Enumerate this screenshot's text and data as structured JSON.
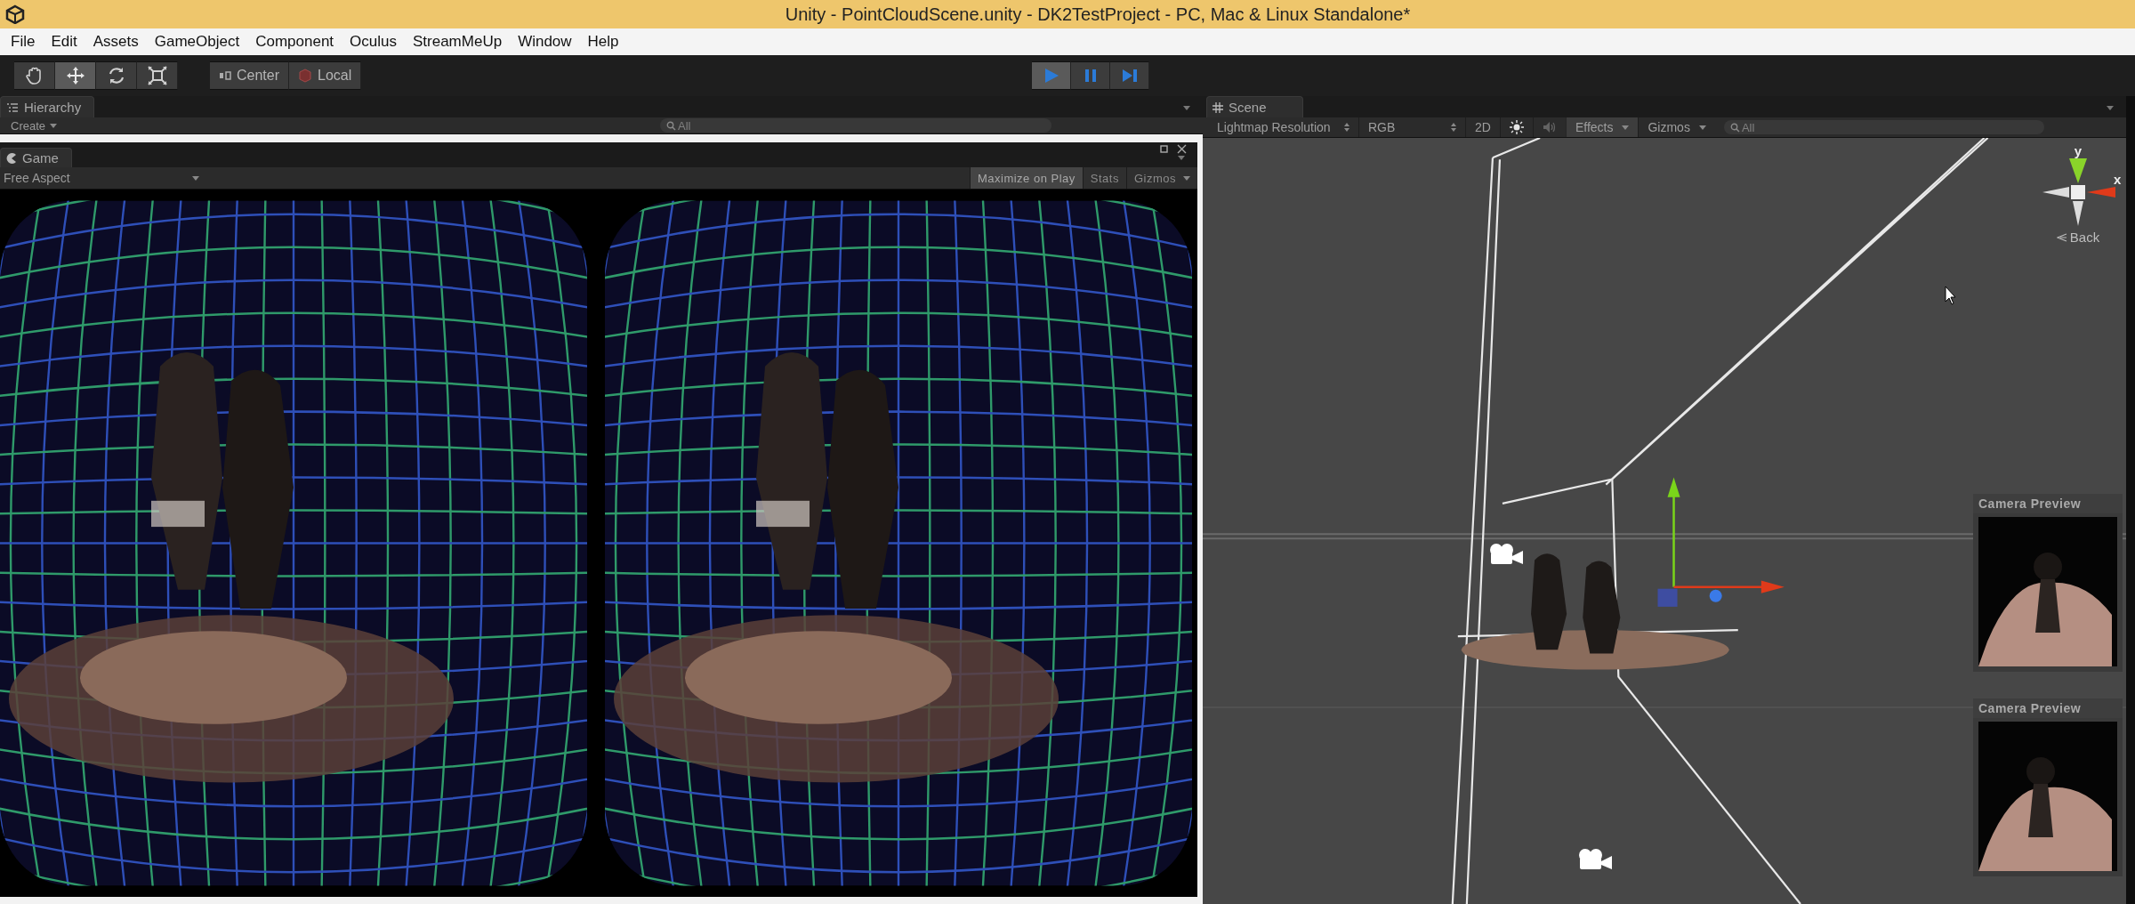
{
  "window": {
    "title": "Unity - PointCloudScene.unity - DK2TestProject - PC, Mac & Linux Standalone*"
  },
  "menu": [
    "File",
    "Edit",
    "Assets",
    "GameObject",
    "Component",
    "Oculus",
    "StreamMeUp",
    "Window",
    "Help"
  ],
  "toolbar": {
    "tools": [
      {
        "kind": "hand",
        "selected": false
      },
      {
        "kind": "move",
        "selected": true
      },
      {
        "kind": "rotate",
        "selected": false
      },
      {
        "kind": "scale",
        "selected": false
      }
    ],
    "pivot": [
      {
        "kind": "pivot",
        "label": "Center"
      },
      {
        "kind": "space",
        "label": "Local"
      }
    ],
    "play": [
      {
        "kind": "play",
        "selected": true
      },
      {
        "kind": "pause",
        "selected": false
      },
      {
        "kind": "step",
        "selected": false
      }
    ]
  },
  "hierarchy": {
    "tab": "Hierarchy",
    "create": "Create",
    "search": {
      "placeholder": "All"
    }
  },
  "game": {
    "tab": "Game",
    "aspect": "Free Aspect",
    "buttons": [
      {
        "label": "Maximize on Play",
        "on": true,
        "kind": "toggle"
      },
      {
        "label": "Stats",
        "on": false,
        "kind": "toggle"
      },
      {
        "label": "Gizmos",
        "on": false,
        "kind": "dropdown"
      }
    ]
  },
  "scene": {
    "tab": "Scene",
    "render_mode": "Lightmap Resolution",
    "color_mode": "RGB",
    "mode_2d": "2D",
    "lighting_on": true,
    "audio_on": false,
    "effects": {
      "label": "Effects",
      "on": true
    },
    "gizmos": "Gizmos",
    "search": {
      "placeholder": "All"
    },
    "orientation_gizmo": {
      "y_label": "y",
      "x_label": "x",
      "view": "Back"
    },
    "camera_previews": [
      {
        "title": "Camera Preview"
      },
      {
        "title": "Camera Preview"
      }
    ]
  }
}
